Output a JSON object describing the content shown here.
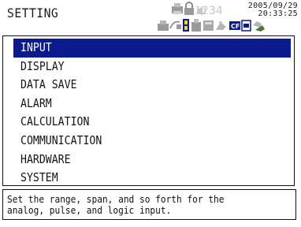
{
  "header": {
    "title": "SETTING",
    "date": "2005/09/29",
    "time": "20:33:25",
    "counter": "1234",
    "status_icons": [
      "printer-icon",
      "lock-icon",
      "sound-icon",
      "network-icon",
      "battery-icon",
      "memory-icon",
      "disk-icon",
      "cf-card-icon",
      "document-icon",
      "hand-icon"
    ],
    "icons_highlight_color": "#0b1a8c"
  },
  "menu": {
    "selected_index": 0,
    "items": [
      {
        "label": "INPUT"
      },
      {
        "label": "DISPLAY"
      },
      {
        "label": "DATA SAVE"
      },
      {
        "label": "ALARM"
      },
      {
        "label": "CALCULATION"
      },
      {
        "label": "COMMUNICATION"
      },
      {
        "label": "HARDWARE"
      },
      {
        "label": "SYSTEM"
      }
    ]
  },
  "help": {
    "line1": "Set the range, span, and so forth for the",
    "line2": "analog, pulse, and logic input."
  },
  "colors": {
    "selection": "#0b1a8c",
    "text": "#141414",
    "background": "#ffffff"
  }
}
